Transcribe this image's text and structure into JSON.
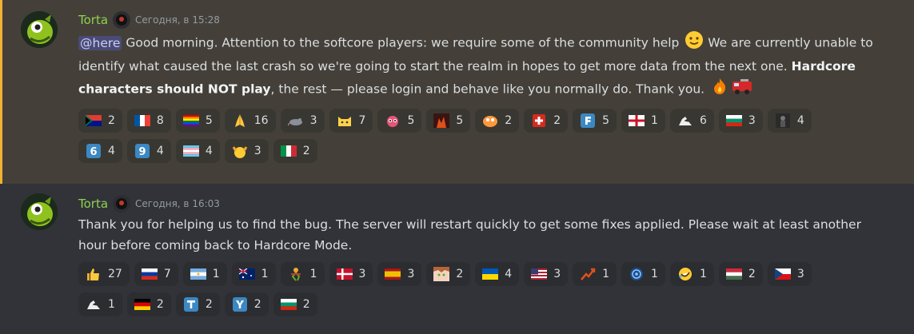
{
  "messages": [
    {
      "username": "Torta",
      "timestamp": "Сегодня, в 15:28",
      "mention": "@here",
      "text1": " Good morning. Attention to the softcore players: we require some of the community help ",
      "text2": " We are currently unable to identify what caused the last crash so we're going to start the realm in hopes to get more data from the next one. ",
      "bold": "Hardcore characters should NOT play",
      "text3": ", the rest — please login and behave like you normally do. Thank you. ",
      "inline_emojis": [
        "slightly-smiling-face-icon",
        "fire-icon",
        "fire-engine-icon"
      ],
      "reactions": [
        {
          "icon": "flag-south-africa-icon",
          "count": "2"
        },
        {
          "icon": "flag-france-icon",
          "count": "8"
        },
        {
          "icon": "rainbow-flag-icon",
          "count": "5"
        },
        {
          "icon": "folded-hands-icon",
          "count": "16"
        },
        {
          "icon": "rat-icon",
          "count": "3"
        },
        {
          "icon": "cat-emote-icon",
          "count": "7"
        },
        {
          "icon": "pink-creature-icon",
          "count": "5"
        },
        {
          "icon": "fire-creature-icon",
          "count": "5"
        },
        {
          "icon": "pepe-icon",
          "count": "2"
        },
        {
          "icon": "flag-switzerland-icon",
          "count": "2"
        },
        {
          "icon": "letter-f-icon",
          "count": "5"
        },
        {
          "icon": "flag-england-icon",
          "count": "1"
        },
        {
          "icon": "flexed-arm-icon",
          "count": "6"
        },
        {
          "icon": "flag-bulgaria-icon",
          "count": "3"
        },
        {
          "icon": "dark-figure-icon",
          "count": "4"
        },
        {
          "icon": "keycap-6-icon",
          "count": "4"
        },
        {
          "icon": "keycap-9-icon",
          "count": "4"
        },
        {
          "icon": "transgender-flag-icon",
          "count": "4"
        },
        {
          "icon": "raised-hands-icon",
          "count": "3"
        },
        {
          "icon": "flag-italy-icon",
          "count": "2"
        }
      ]
    },
    {
      "username": "Torta",
      "timestamp": "Сегодня, в 16:03",
      "text": "Thank you for helping us to find the bug. The server will restart quickly to get some fixes applied. Please wait at least another hour before coming back to Hardcore Mode.",
      "reactions": [
        {
          "icon": "thumbs-up-icon",
          "count": "27"
        },
        {
          "icon": "flag-russia-icon",
          "count": "7"
        },
        {
          "icon": "flag-argentina-icon",
          "count": "1"
        },
        {
          "icon": "flag-australia-icon",
          "count": "1"
        },
        {
          "icon": "dancing-figure-icon",
          "count": "1"
        },
        {
          "icon": "flag-denmark-icon",
          "count": "3"
        },
        {
          "icon": "flag-spain-icon",
          "count": "3"
        },
        {
          "icon": "anime-face-icon",
          "count": "2"
        },
        {
          "icon": "flag-ukraine-icon",
          "count": "4"
        },
        {
          "icon": "flag-usa-icon",
          "count": "3"
        },
        {
          "icon": "chart-up-icon",
          "count": "1"
        },
        {
          "icon": "cm-logo-icon",
          "count": "1"
        },
        {
          "icon": "rofl-face-icon",
          "count": "1"
        },
        {
          "icon": "flag-hungary-icon",
          "count": "2"
        },
        {
          "icon": "flag-czech-icon",
          "count": "3"
        },
        {
          "icon": "flexed-arm-icon",
          "count": "1"
        },
        {
          "icon": "flag-germany-icon",
          "count": "2"
        },
        {
          "icon": "letter-t-icon",
          "count": "2"
        },
        {
          "icon": "letter-y-icon",
          "count": "2"
        },
        {
          "icon": "flag-bulgaria-icon",
          "count": "2"
        }
      ]
    }
  ],
  "colors": {
    "background": "#313338",
    "highlight": "#444039",
    "highlight_border": "#f0b232",
    "username": "#8fd14f",
    "mention_bg": "#3c4270"
  }
}
